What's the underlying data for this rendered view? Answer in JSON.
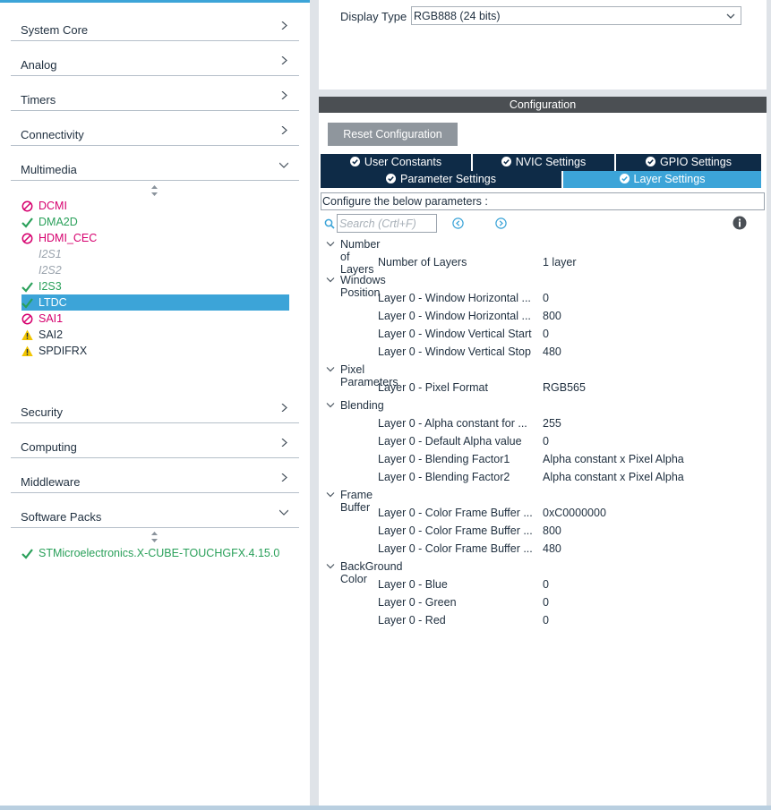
{
  "sidebar": {
    "categories_top": [
      {
        "label": "System Core",
        "icon": "chevron-right-icon"
      },
      {
        "label": "Analog",
        "icon": "chevron-right-icon"
      },
      {
        "label": "Timers",
        "icon": "chevron-right-icon"
      },
      {
        "label": "Connectivity",
        "icon": "chevron-right-icon"
      },
      {
        "label": "Multimedia",
        "icon": "chevron-down-icon"
      }
    ],
    "multimedia_items": [
      {
        "label": "DCMI",
        "status": "disabled"
      },
      {
        "label": "DMA2D",
        "status": "ok"
      },
      {
        "label": "HDMI_CEC",
        "status": "disabled"
      },
      {
        "label": "I2S1",
        "status": "unavailable"
      },
      {
        "label": "I2S2",
        "status": "unavailable"
      },
      {
        "label": "I2S3",
        "status": "ok"
      },
      {
        "label": "LTDC",
        "status": "ok",
        "selected": true
      },
      {
        "label": "SAI1",
        "status": "disabled"
      },
      {
        "label": "SAI2",
        "status": "warning"
      },
      {
        "label": "SPDIFRX",
        "status": "warning"
      }
    ],
    "categories_bottom": [
      {
        "label": "Security",
        "icon": "chevron-right-icon"
      },
      {
        "label": "Computing",
        "icon": "chevron-right-icon"
      },
      {
        "label": "Middleware",
        "icon": "chevron-right-icon"
      },
      {
        "label": "Software Packs",
        "icon": "chevron-down-icon"
      }
    ],
    "software_pack": {
      "label": "STMicroelectronics.X-CUBE-TOUCHGFX.4.15.0",
      "status": "ok"
    }
  },
  "display": {
    "label": "Display Type",
    "value": "RGB888 (24 bits)"
  },
  "config": {
    "header": "Configuration",
    "reset_label": "Reset Configuration",
    "tabs_row1": [
      "User Constants",
      "NVIC Settings",
      "GPIO Settings"
    ],
    "tabs_row2": [
      "Parameter Settings",
      "Layer Settings"
    ],
    "active_tab": "Layer Settings",
    "caption": "Configure the below parameters :",
    "search_placeholder": "Search (Crtl+F)",
    "groups": [
      {
        "name": "Number of Layers",
        "params": [
          {
            "name": "Number of Layers",
            "value": "1 layer"
          }
        ]
      },
      {
        "name": "Windows Position",
        "params": [
          {
            "name": "Layer 0 - Window Horizontal ...",
            "value": "0"
          },
          {
            "name": "Layer 0 - Window Horizontal ...",
            "value": "800"
          },
          {
            "name": "Layer 0 - Window Vertical Start",
            "value": "0"
          },
          {
            "name": "Layer 0 - Window Vertical Stop",
            "value": "480"
          }
        ]
      },
      {
        "name": "Pixel Parameters",
        "params": [
          {
            "name": "Layer 0 - Pixel Format",
            "value": "RGB565"
          }
        ]
      },
      {
        "name": "Blending",
        "params": [
          {
            "name": "Layer 0 - Alpha constant for ...",
            "value": "255"
          },
          {
            "name": "Layer 0 - Default Alpha value",
            "value": "0"
          },
          {
            "name": "Layer 0 - Blending Factor1",
            "value": "Alpha constant x Pixel Alpha"
          },
          {
            "name": "Layer 0 - Blending Factor2",
            "value": "Alpha constant x Pixel Alpha"
          }
        ]
      },
      {
        "name": "Frame Buffer",
        "params": [
          {
            "name": "Layer 0 - Color Frame Buffer ...",
            "value": "0xC0000000"
          },
          {
            "name": "Layer 0 - Color Frame Buffer ...",
            "value": "800"
          },
          {
            "name": "Layer 0 - Color Frame Buffer ...",
            "value": "480"
          }
        ]
      },
      {
        "name": "BackGround Color",
        "params": [
          {
            "name": "Layer 0 - Blue",
            "value": "0"
          },
          {
            "name": "Layer 0 - Green",
            "value": "0"
          },
          {
            "name": "Layer 0 - Red",
            "value": "0"
          }
        ]
      }
    ]
  },
  "colors": {
    "accent": "#3ca4d8",
    "tab_dark": "#0e2b47",
    "disabled": "#d6006e",
    "ok": "#2aa05a",
    "warning": "#f2c500"
  }
}
